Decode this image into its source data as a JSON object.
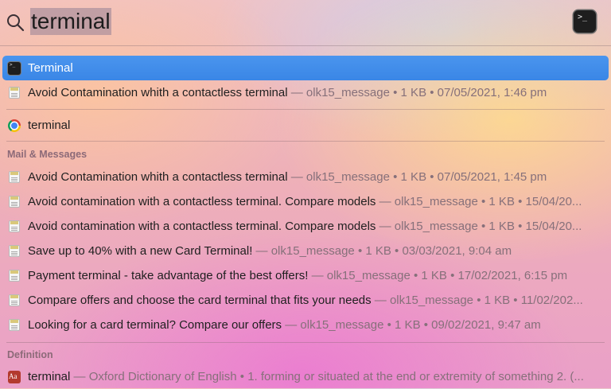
{
  "search": {
    "query": "terminal"
  },
  "top_hits": [
    {
      "title": "Terminal",
      "meta": "",
      "icon": "terminal-icon"
    },
    {
      "title": "Avoid Contamination whith a contactless terminal",
      "meta": " — olk15_message • 1 KB • 07/05/2021, 1:46 pm",
      "icon": "mail-icon"
    }
  ],
  "web_suggestion": {
    "title": "terminal",
    "icon": "chrome-icon"
  },
  "sections": {
    "mail": {
      "label": "Mail & Messages",
      "items": [
        {
          "title": "Avoid Contamination whith a contactless terminal",
          "meta": " — olk15_message • 1 KB • 07/05/2021, 1:45 pm"
        },
        {
          "title": "Avoid contamination with a contactless terminal. Compare models",
          "meta": " — olk15_message • 1 KB • 15/04/20..."
        },
        {
          "title": "Avoid contamination with a contactless terminal. Compare models",
          "meta": " — olk15_message • 1 KB • 15/04/20..."
        },
        {
          "title": "Save up to 40% with a new Card Terminal!",
          "meta": " — olk15_message • 1 KB • 03/03/2021, 9:04 am"
        },
        {
          "title": "Payment terminal - take advantage of the best offers!",
          "meta": " — olk15_message • 1 KB • 17/02/2021, 6:15 pm"
        },
        {
          "title": "Compare offers and choose the card terminal that fits your needs",
          "meta": " — olk15_message • 1 KB • 11/02/202..."
        },
        {
          "title": "Looking for a card terminal? Compare our offers",
          "meta": " — olk15_message • 1 KB • 09/02/2021, 9:47 am"
        }
      ]
    },
    "definition": {
      "label": "Definition",
      "items": [
        {
          "title": "terminal",
          "meta": " — Oxford Dictionary of English • 1. forming or situated at the end or extremity of something 2. (..."
        }
      ]
    }
  },
  "icons": {
    "terminal_glyph": ">_",
    "dict_glyph": "Aa"
  },
  "colors": {
    "selection": "#3a86e6",
    "meta_text": "#86707a",
    "section_label": "#8c6a78"
  }
}
